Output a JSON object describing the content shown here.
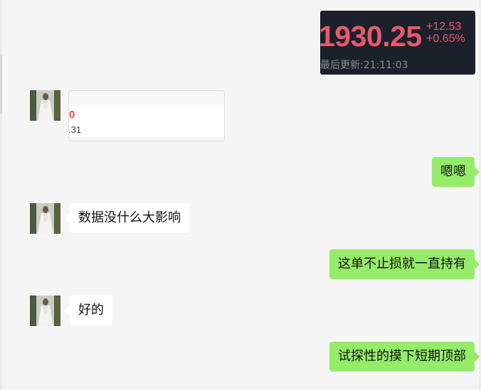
{
  "stock_card": {
    "price": "1930.25",
    "change": "+12.53",
    "change_pct": "+0.65%",
    "updated": "最后更新:21:11:03"
  },
  "link_card": {
    "fragment_red": "0",
    "fragment_value": ".31"
  },
  "messages": [
    {
      "sender": "me",
      "text": "嗯嗯"
    },
    {
      "sender": "other",
      "text": "数据没什么大影响"
    },
    {
      "sender": "me",
      "text": "这单不止损就一直持有"
    },
    {
      "sender": "other",
      "text": "好的"
    },
    {
      "sender": "me",
      "text": "试探性的摸下短期顶部"
    }
  ],
  "colors": {
    "background": "#f5f5f5",
    "incoming_bubble": "#ffffff",
    "outgoing_bubble": "#95ec69",
    "stock_up": "#e8596a",
    "stock_bg": "#1b202b"
  }
}
